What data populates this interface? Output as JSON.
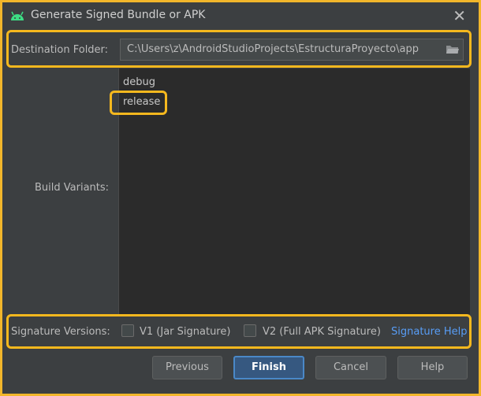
{
  "window": {
    "title": "Generate Signed Bundle or APK",
    "close_glyph": "✕"
  },
  "destination": {
    "label": "Destination Folder:",
    "value": "C:\\Users\\z\\AndroidStudioProjects\\EstructuraProyecto\\app"
  },
  "build_variants": {
    "label": "Build Variants:",
    "items": [
      {
        "label": "debug"
      },
      {
        "label": "release"
      }
    ]
  },
  "signature": {
    "label": "Signature Versions:",
    "v1_label": "V1 (Jar Signature)",
    "v2_label": "V2 (Full APK Signature)",
    "v1_checked": false,
    "v2_checked": false,
    "help_link": "Signature Help"
  },
  "buttons": {
    "previous": "Previous",
    "finish": "Finish",
    "cancel": "Cancel",
    "help": "Help"
  },
  "colors": {
    "highlight": "#f5b81e",
    "window_bg": "#3c3f41",
    "link": "#589df6",
    "android": "#3ddc84"
  },
  "icons": {
    "app": "android-icon",
    "close": "close-icon",
    "folder": "folder-open-icon"
  }
}
